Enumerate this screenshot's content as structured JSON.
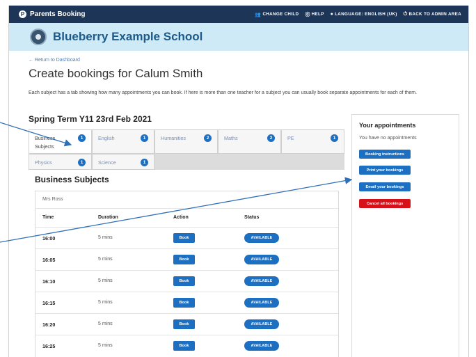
{
  "topbar": {
    "brand": "Parents Booking",
    "nav": [
      {
        "icon": "people-icon",
        "label": "CHANGE CHILD"
      },
      {
        "icon": "help-icon",
        "label": "HELP"
      },
      {
        "icon": "globe-icon",
        "label": "LANGUAGE: ENGLISH (UK)"
      },
      {
        "icon": "power-icon",
        "label": "BACK TO ADMIN AREA"
      }
    ]
  },
  "school": {
    "name": "Blueberry Example School"
  },
  "return_link": "← Return to Dashboard",
  "page_title": "Create bookings for Calum Smith",
  "intro": "Each subject has a tab showing how many appointments you can book. If here is more than one teacher for a subject you can usually book separate appointments for each of them.",
  "term": "Spring Term Y11 23rd Feb 2021",
  "tabs": [
    {
      "label": "Business Subjects",
      "count": "1"
    },
    {
      "label": "English",
      "count": "1"
    },
    {
      "label": "Humanities",
      "count": "2"
    },
    {
      "label": "Maths",
      "count": "2"
    },
    {
      "label": "PE",
      "count": "1"
    },
    {
      "label": "Physics",
      "count": "1"
    },
    {
      "label": "Science",
      "count": "1"
    }
  ],
  "section_title": "Business Subjects",
  "teacher": "Mrs Ross",
  "table": {
    "headers": [
      "Time",
      "Duration",
      "Action",
      "Status"
    ],
    "rows": [
      {
        "time": "16:00",
        "duration": "5 mins",
        "action": "Book",
        "status": "AVAILABLE"
      },
      {
        "time": "16:05",
        "duration": "5 mins",
        "action": "Book",
        "status": "AVAILABLE"
      },
      {
        "time": "16:10",
        "duration": "5 mins",
        "action": "Book",
        "status": "AVAILABLE"
      },
      {
        "time": "16:15",
        "duration": "5 mins",
        "action": "Book",
        "status": "AVAILABLE"
      },
      {
        "time": "16:20",
        "duration": "5 mins",
        "action": "Book",
        "status": "AVAILABLE"
      },
      {
        "time": "16:25",
        "duration": "5 mins",
        "action": "Book",
        "status": "AVAILABLE"
      }
    ]
  },
  "appointments": {
    "title": "Your appointments",
    "none": "You have no appointments",
    "buttons": [
      {
        "label": "Booking instructions",
        "color": "#1d6fc2"
      },
      {
        "label": "Print your bookings",
        "color": "#1d6fc2"
      },
      {
        "label": "Email your bookings",
        "color": "#1d6fc2"
      },
      {
        "label": "Cancel all bookings",
        "color": "#d7111a"
      }
    ]
  },
  "colors": {
    "topbar": "#1d3557",
    "school_bar": "#cdeaf6",
    "accent": "#1d6fc2",
    "danger": "#d7111a"
  }
}
